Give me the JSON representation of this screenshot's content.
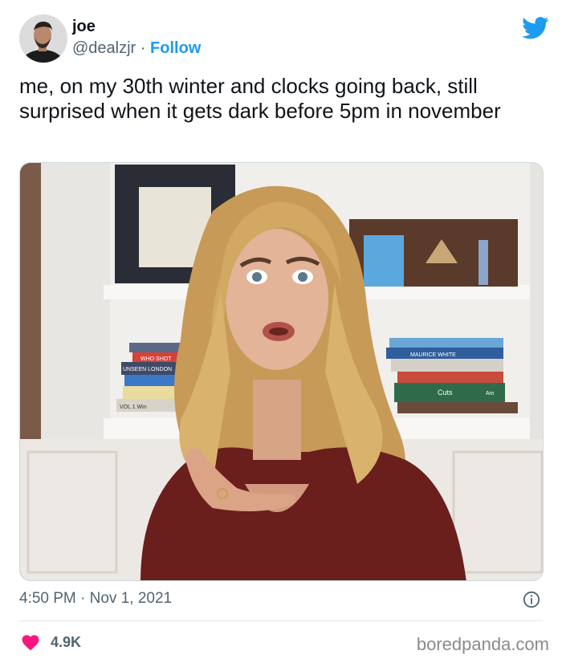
{
  "author": {
    "name": "joe",
    "handle": "@dealzjr",
    "separator": "·",
    "follow_label": "Follow"
  },
  "tweet": {
    "text": "me, on my 30th winter and clocks going back, still surprised when it gets dark before 5pm in november",
    "time": "4:50 PM · Nov 1, 2021",
    "likes": "4.9K"
  },
  "media": {
    "books_left": [
      "WHO SHOT",
      "UNSEEN LONDON",
      "VOL 1 Win"
    ],
    "books_right": [
      "MAURICE WHITE",
      "Cuts",
      "Am"
    ]
  },
  "icons": {
    "brand": "twitter-bird-icon",
    "info": "info-icon",
    "like": "heart-icon"
  },
  "colors": {
    "accent": "#1d9bf0",
    "heart": "#f91880",
    "muted": "#536471",
    "text": "#0f1419"
  },
  "watermark": "boredpanda.com"
}
